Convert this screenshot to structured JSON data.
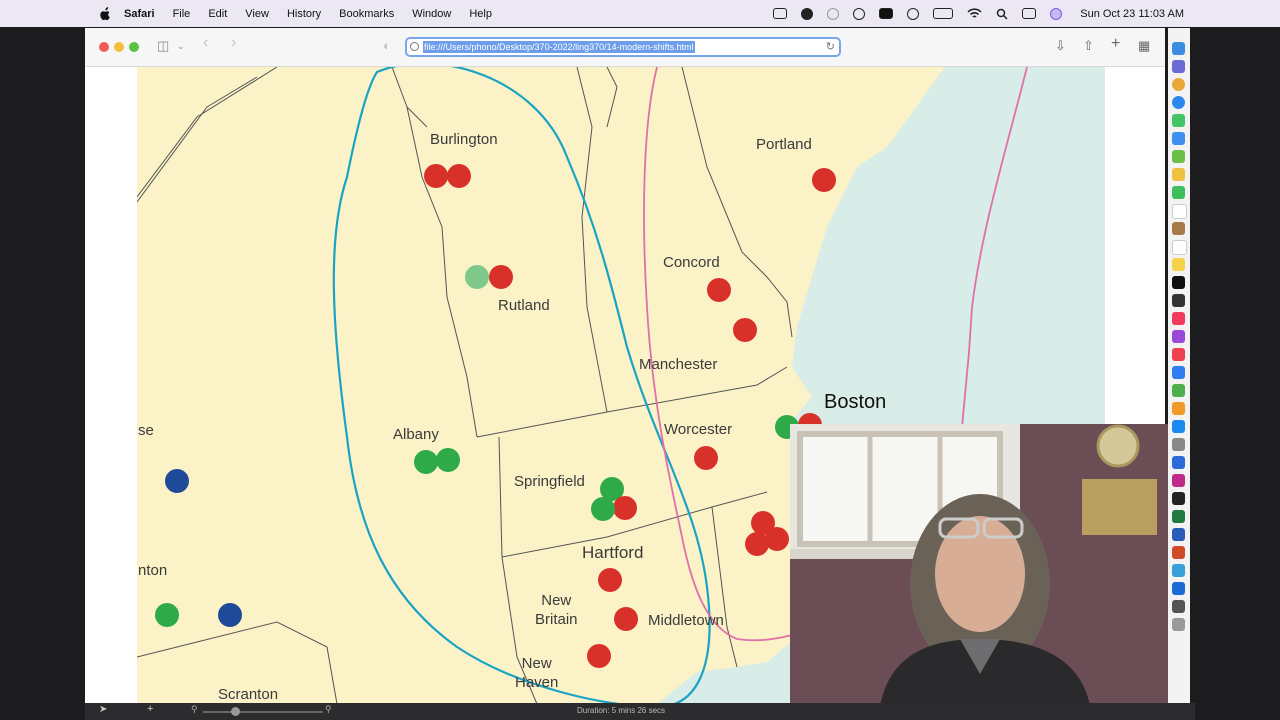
{
  "menubar": {
    "app_name": "Safari",
    "items": [
      "File",
      "Edit",
      "View",
      "History",
      "Bookmarks",
      "Window",
      "Help"
    ],
    "clock": "Sun Oct 23  11:03 AM",
    "status_icons": [
      "camera-icon",
      "record-icon",
      "vpn-icon",
      "time-machine-icon",
      "li-icon",
      "play-icon",
      "battery-icon",
      "wifi-icon",
      "search-icon",
      "control-center-icon",
      "siri-icon"
    ]
  },
  "browser": {
    "url": "file:///Users/phono/Desktop/370-2022/ling370/14-modern-shifts.html",
    "toolbar_icons": [
      "sidebar-icon",
      "back-icon",
      "forward-icon",
      "shield-icon",
      "download-icon",
      "share-icon",
      "new-tab-icon",
      "tab-overview-icon"
    ]
  },
  "map": {
    "colors": {
      "land": "#fbf2c8",
      "water": "#d8ece8",
      "border": "#555555",
      "isogloss_blue": "#1aa3c4",
      "isogloss_pink": "#e070a8",
      "dot_red": "#d8312a",
      "dot_green": "#2eaa48",
      "dot_light_green": "#7fc98a",
      "dot_blue": "#1f4a9a"
    },
    "labels": {
      "burlington": "Burlington",
      "portland": "Portland",
      "concord": "Concord",
      "rutland": "Rutland",
      "manchester": "Manchester",
      "boston": "Boston",
      "albany": "Albany",
      "worcester": "Worcester",
      "se": "se",
      "springfield": "Springfield",
      "hartford": "Hartford",
      "nton": "nton",
      "new_britain": "New\nBritain",
      "middletown": "Middletown",
      "new_haven": "New\nHaven",
      "scranton": "Scranton"
    }
  },
  "bottombar": {
    "duration": "Duration: 5 mins 26 secs"
  }
}
